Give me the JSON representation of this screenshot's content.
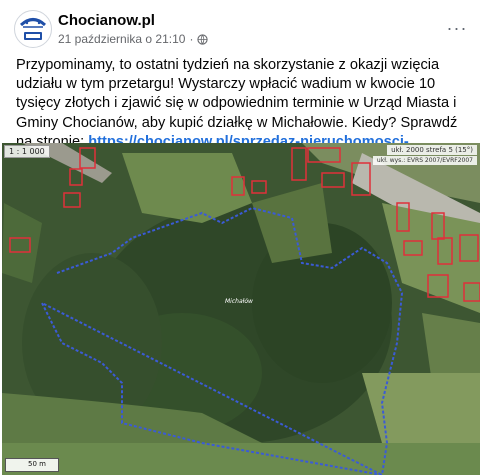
{
  "post": {
    "author": "Chocianow.pl",
    "timestamp": "21 października o 21:10",
    "separator": "·",
    "more_label": "···",
    "body_text": "Przypominamy, to ostatni tydzień na skorzystanie z okazji wzięcia udziału w tym przetargu! Wystarczy wpłacić wadium w kwocie 10 tysięcy złotych i zjawić się w odpowiednim terminie w Urząd Miasta i Gminy Chocianów, aby kupić działkę w Michałowie. Kiedy? Sprawdź na stronie: ",
    "link_text": "https://chocianow.pl/sprzedaz-nieruchomosci-gruntowej..."
  },
  "map": {
    "scale_text": "1 : 1 000",
    "coords_text": "ukł. 2000 strefa 5 (15°)",
    "coords_sub": "ukł. wys.: EVRS 2007/EVRF2007",
    "scalebar_text": "50 m",
    "plot_label": "Michałów"
  },
  "colors": {
    "link": "#216fdb",
    "plot_boundary": "#3b5bd6",
    "building_outline": "#e0303a"
  }
}
